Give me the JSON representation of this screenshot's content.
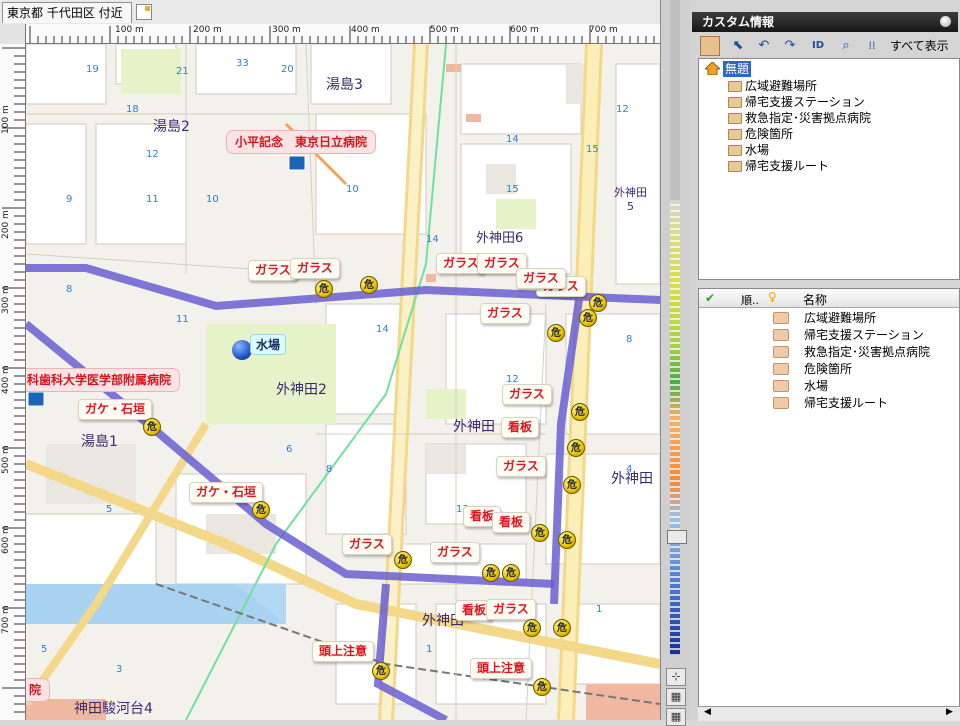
{
  "tab": {
    "title": "東京都 千代田区 付近"
  },
  "ruler": {
    "top_labels": [
      "100 m",
      "200 m",
      "300 m",
      "400 m",
      "500 m",
      "600 m",
      "700 m"
    ],
    "left_labels": [
      "100 m",
      "200 m",
      "300 m",
      "400 m",
      "500 m",
      "600 m",
      "700 m"
    ]
  },
  "map": {
    "areas": [
      "湯島3",
      "湯島2",
      "外神田6",
      "外神田\n5",
      "外神田2",
      "外神田",
      "湯島1",
      "外神田",
      "外神田",
      "神田駿河台4"
    ],
    "hospitals": [
      "小平記念　東京日立病院",
      "科歯科大学医学部附属病院",
      "院"
    ],
    "water": "水場",
    "hazard_labels": [
      "ガラス",
      "ガラス",
      "ガラス",
      "ガラス",
      "ガラス",
      "ガラス",
      "ガラス",
      "ガラス",
      "看板",
      "ガラス",
      "看板",
      "看板",
      "ガラス",
      "ガラス",
      "看板",
      "ガラス",
      "ガケ・石垣",
      "ガケ・石垣",
      "頭上注意",
      "頭上注意"
    ],
    "danger_glyph": "危"
  },
  "panel": {
    "title": "カスタム情報",
    "show_all": "すべて表示",
    "tree_root": "無題",
    "tree_items": [
      "広域避難場所",
      "帰宅支援ステーション",
      "救急指定･災害拠点病院",
      "危険箇所",
      "水場",
      "帰宅支援ルート"
    ],
    "list_headers": {
      "order": "順..",
      "name": "名称"
    },
    "list_items": [
      "広域避難場所",
      "帰宅支援ステーション",
      "救急指定･災害拠点病院",
      "危険箇所",
      "水場",
      "帰宅支援ルート"
    ]
  },
  "colors": {
    "route": "#6a5fd2",
    "hazard_text": "#e0141e",
    "panel_header": "#232323",
    "rail_green": "#6fe0a0"
  }
}
